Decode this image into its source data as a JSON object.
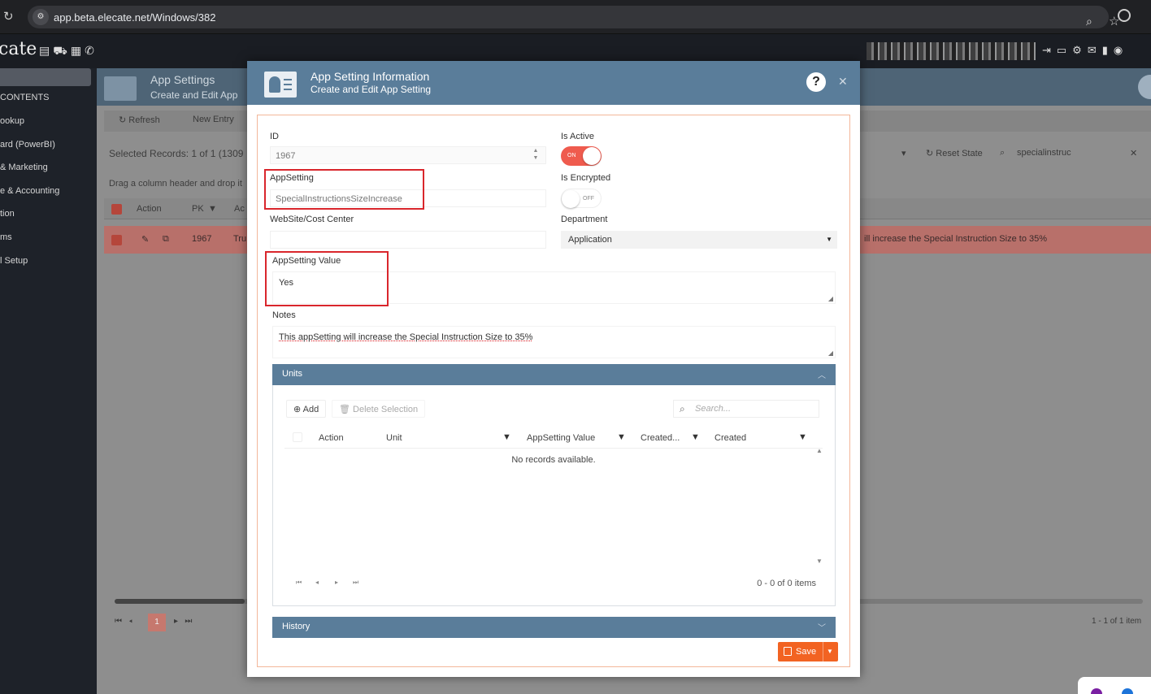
{
  "browser": {
    "url": "app.beta.elecate.net/Windows/382"
  },
  "app": {
    "logo": "cate"
  },
  "sidebar": {
    "items": [
      {
        "label": "CONTENTS"
      },
      {
        "label": "ookup"
      },
      {
        "label": "ard (PowerBI)"
      },
      {
        "label": "& Marketing"
      },
      {
        "label": "e & Accounting"
      },
      {
        "label": "tion"
      },
      {
        "label": "ms"
      },
      {
        "label": "l Setup"
      }
    ]
  },
  "background_page": {
    "title": "App Settings",
    "subtitle": "Create and Edit App",
    "toolbar": {
      "refresh": "Refresh",
      "new_entry": "New Entry"
    },
    "selected_records": "Selected Records: 1 of 1 (1309",
    "drag_hint": "Drag a column header and drop it",
    "reset_state": "Reset State",
    "search_value": "specialinstruc",
    "columns": [
      "Action",
      "PK",
      "Ac"
    ],
    "row": {
      "pk": "1967",
      "flag": "Tru",
      "notes": "ill increase the Special Instruction Size to 35%"
    },
    "pager": {
      "current_page": "1",
      "info": "1 - 1 of 1 item"
    }
  },
  "modal": {
    "title": "App Setting Information",
    "subtitle": "Create and Edit App Setting",
    "help": "?",
    "fields": {
      "id_label": "ID",
      "id_value": "1967",
      "is_active_label": "Is Active",
      "is_active_text": "ON",
      "is_active": true,
      "appsetting_label": "AppSetting",
      "appsetting_value": "SpecialInstructionsSizeIncrease",
      "is_encrypted_label": "Is Encrypted",
      "is_encrypted_text": "OFF",
      "is_encrypted": false,
      "website_label": "WebSite/Cost Center",
      "website_value": "",
      "department_label": "Department",
      "department_value": "Application",
      "appsetting_value_label": "AppSetting Value",
      "appsetting_value_value": "Yes",
      "notes_label": "Notes",
      "notes_value": "This appSetting will increase the Special Instruction Size to 35%"
    },
    "units": {
      "title": "Units",
      "add": "Add",
      "delete_selection": "Delete Selection",
      "search_placeholder": "Search...",
      "columns": [
        "Action",
        "Unit",
        "AppSetting Value",
        "Created...",
        "Created"
      ],
      "empty": "No records available.",
      "pager_info": "0 - 0 of 0 items"
    },
    "history": {
      "title": "History"
    },
    "save": "Save"
  },
  "colors": {
    "header_blue": "#5a7d9a",
    "accent_orange": "#f26322",
    "toggle_on": "#ef5b4e",
    "highlight_red": "#d9262c"
  }
}
